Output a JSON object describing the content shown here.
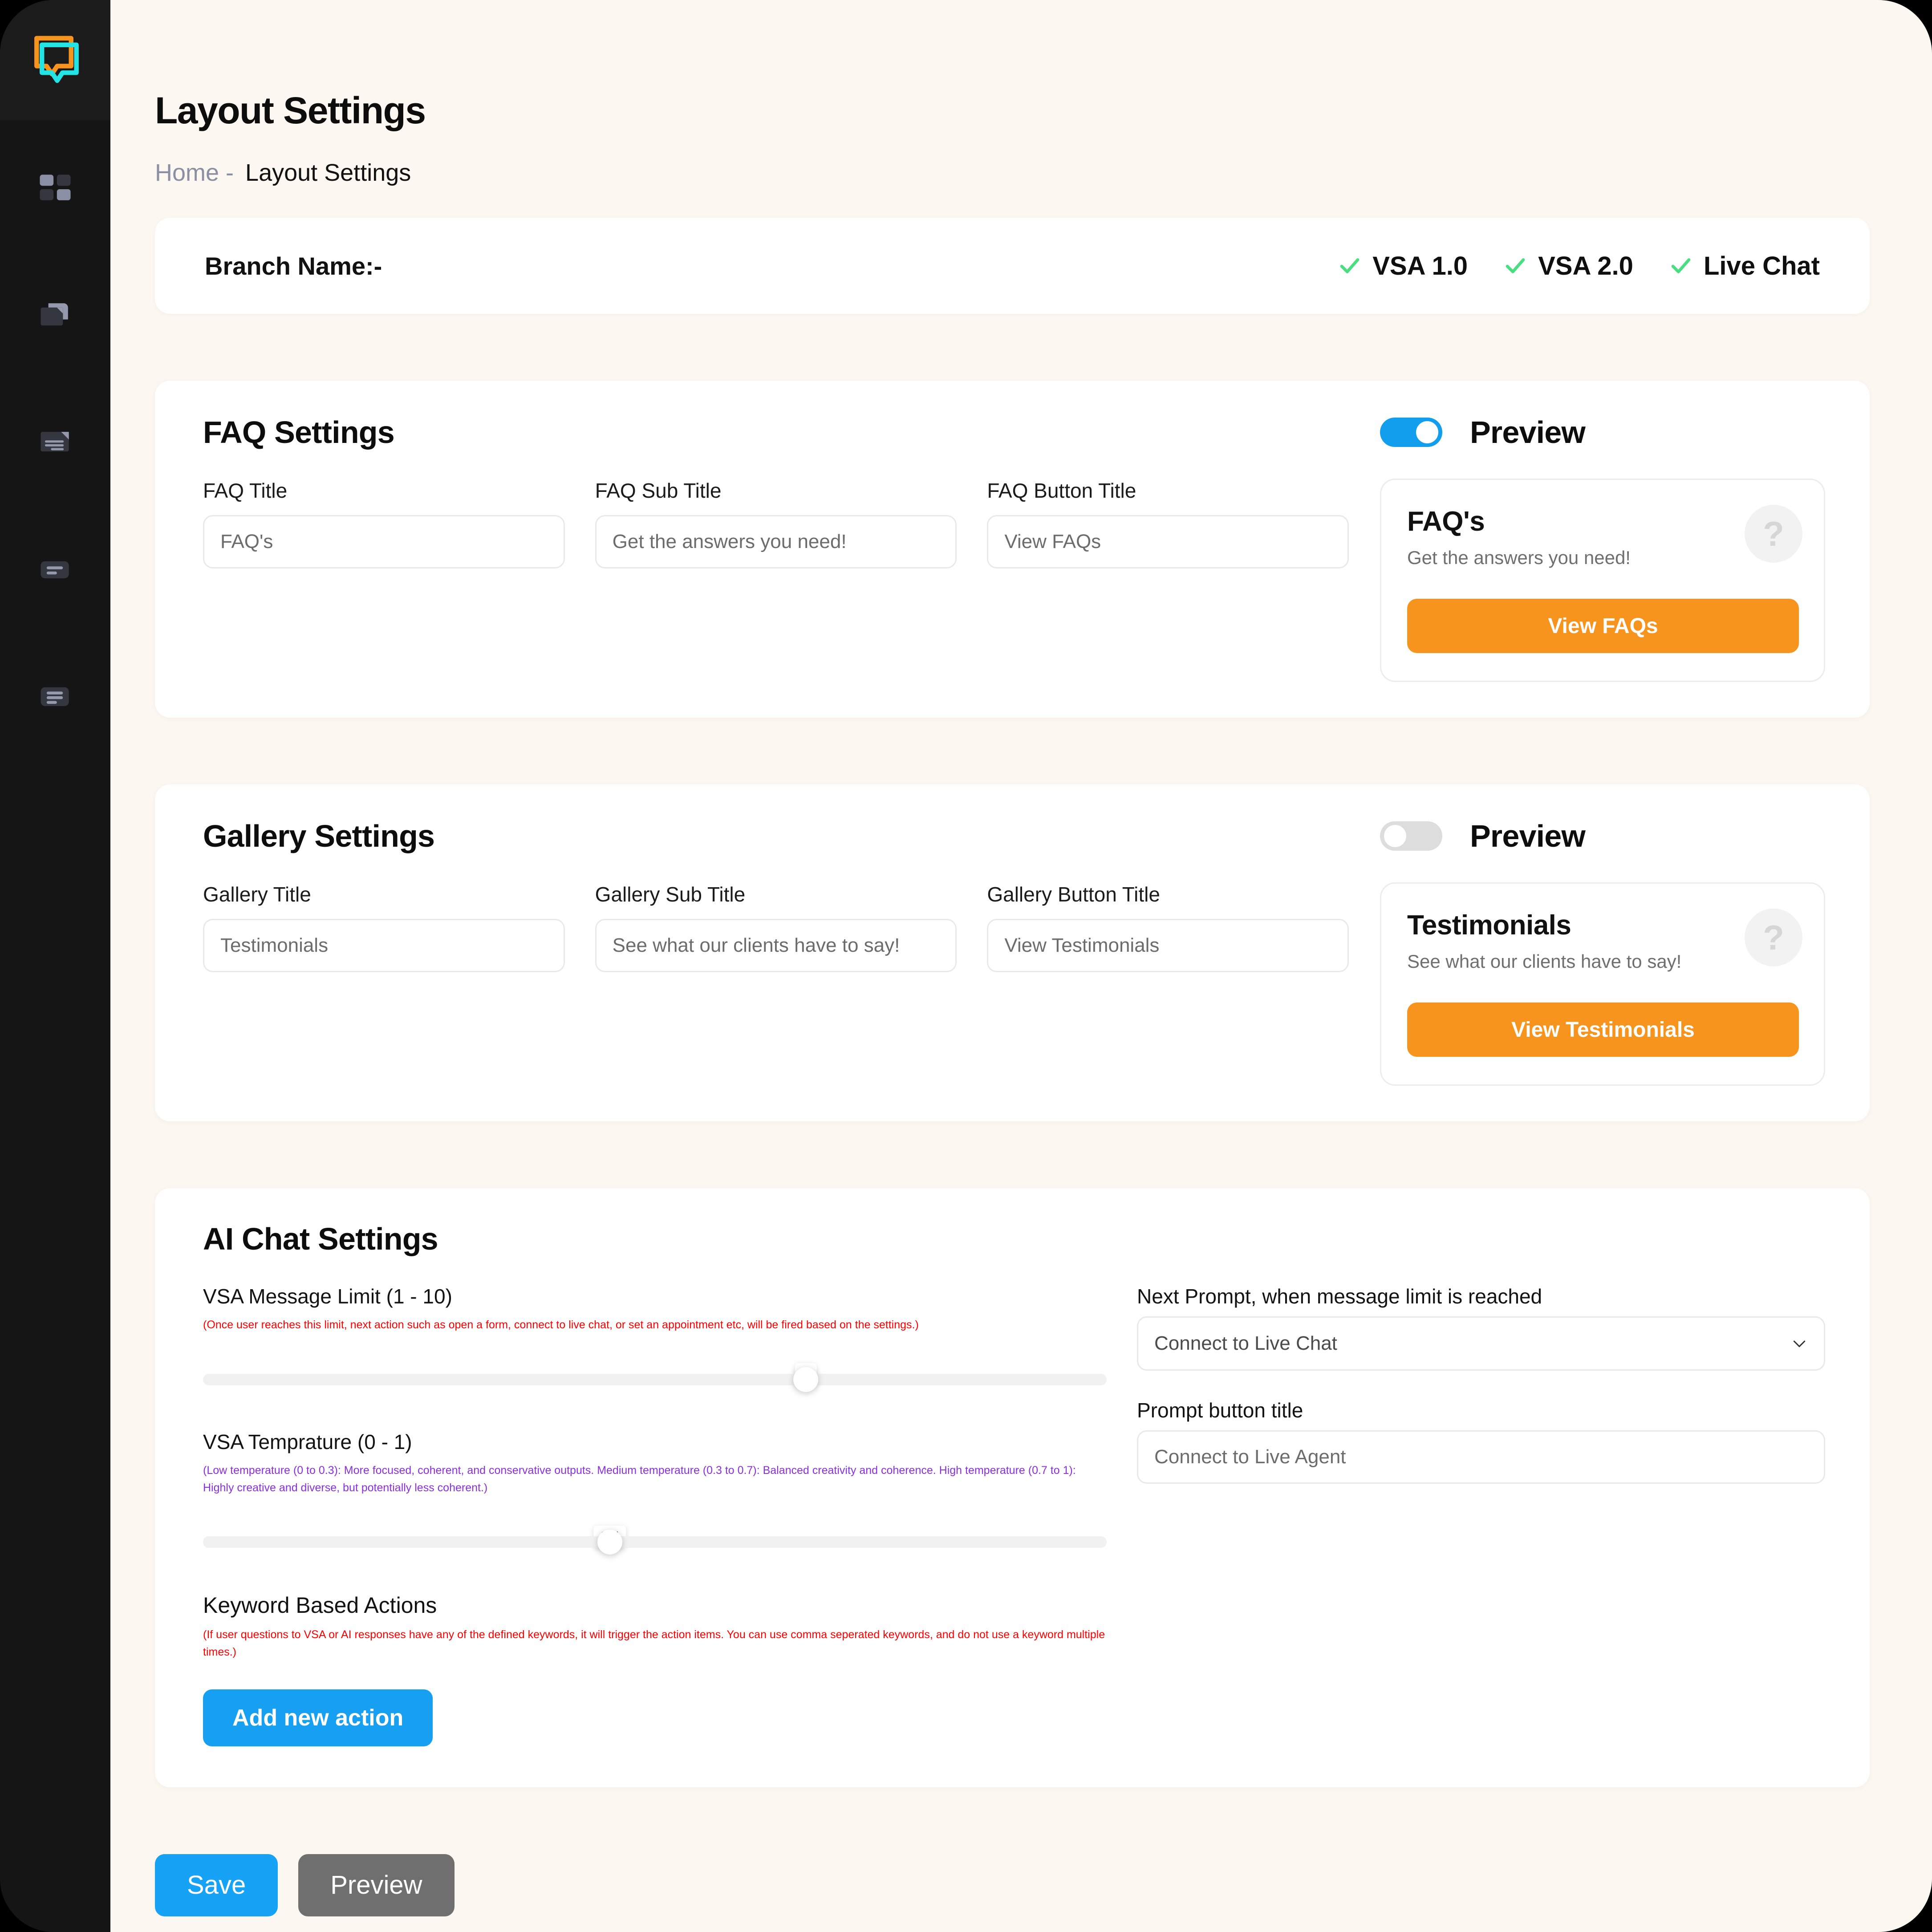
{
  "sidebar": {
    "logo_icon": "chat-bubbles-logo",
    "items": [
      {
        "icon": "dashboard-grid-icon",
        "name": "dashboard"
      },
      {
        "icon": "folder-file-icon",
        "name": "files"
      },
      {
        "icon": "document-lines-icon",
        "name": "documents"
      },
      {
        "icon": "list-block-icon",
        "name": "list-one"
      },
      {
        "icon": "list-block-icon",
        "name": "list-two"
      }
    ]
  },
  "header": {
    "title": "Layout Settings",
    "breadcrumb": {
      "home": "Home -",
      "current": "Layout Settings"
    }
  },
  "branch": {
    "label": "Branch Name:-",
    "flags": [
      {
        "label": "VSA 1.0",
        "checked": true
      },
      {
        "label": "VSA 2.0",
        "checked": true
      },
      {
        "label": "Live Chat",
        "checked": true
      }
    ],
    "check_color": "#4ade80"
  },
  "faq": {
    "section_title": "FAQ Settings",
    "toggle_on": true,
    "preview_title": "Preview",
    "fields": [
      {
        "label": "FAQ Title",
        "value": "FAQ's"
      },
      {
        "label": "FAQ Sub Title",
        "value": "Get the answers you need!"
      },
      {
        "label": "FAQ Button Title",
        "value": "View FAQs"
      }
    ],
    "preview": {
      "title": "FAQ's",
      "subtitle": "Get the answers you need!",
      "button": "View FAQs",
      "help_glyph": "?"
    }
  },
  "gallery": {
    "section_title": "Gallery Settings",
    "toggle_on": false,
    "preview_title": "Preview",
    "fields": [
      {
        "label": "Gallery Title",
        "value": "Testimonials"
      },
      {
        "label": "Gallery Sub Title",
        "value": "See what our clients have to say!"
      },
      {
        "label": "Gallery Button Title",
        "value": "View Testimonials"
      }
    ],
    "preview": {
      "title": "Testimonials",
      "subtitle": "See what our clients have to say!",
      "button": "View Testimonials",
      "help_glyph": "?"
    }
  },
  "ai_chat": {
    "section_title": "AI Chat Settings",
    "message_limit": {
      "label": "VSA Message Limit (1 - 10)",
      "hint": "(Once user reaches this limit, next action such as open a form, connect to live chat, or set an appointment etc, will be fired based on the settings.)",
      "value": "7",
      "min": 1,
      "max": 10,
      "percent": 66.7
    },
    "temperature": {
      "label": "VSA Temprature (0 - 1)",
      "hint": "(Low temperature (0 to 0.3): More focused, coherent, and conservative outputs. Medium temperature (0.3 to 0.7): Balanced creativity and coherence. High temperature (0.7 to 1): Highly creative and diverse, but potentially less coherent.)",
      "value": "0.5",
      "min": 0,
      "max": 1,
      "percent": 45
    },
    "keyword_actions": {
      "label": "Keyword Based Actions",
      "hint": "(If user questions to VSA or AI responses have any of the defined keywords, it will trigger the action items. You can use comma seperated keywords, and do not use a keyword multiple times.)",
      "add_button": "Add new action"
    },
    "next_prompt": {
      "label": "Next Prompt, when message limit is reached",
      "value": "Connect to Live Chat"
    },
    "prompt_button": {
      "label": "Prompt button title",
      "value": "Connect to Live Agent"
    }
  },
  "footer": {
    "save": "Save",
    "preview": "Preview"
  },
  "colors": {
    "accent_blue": "#16a3f5",
    "accent_orange": "#f7941d",
    "page_bg": "#fdf7f1",
    "sidebar_bg": "#151515",
    "hint_red": "#ff0000",
    "hint_purple": "#8b2fe0"
  }
}
